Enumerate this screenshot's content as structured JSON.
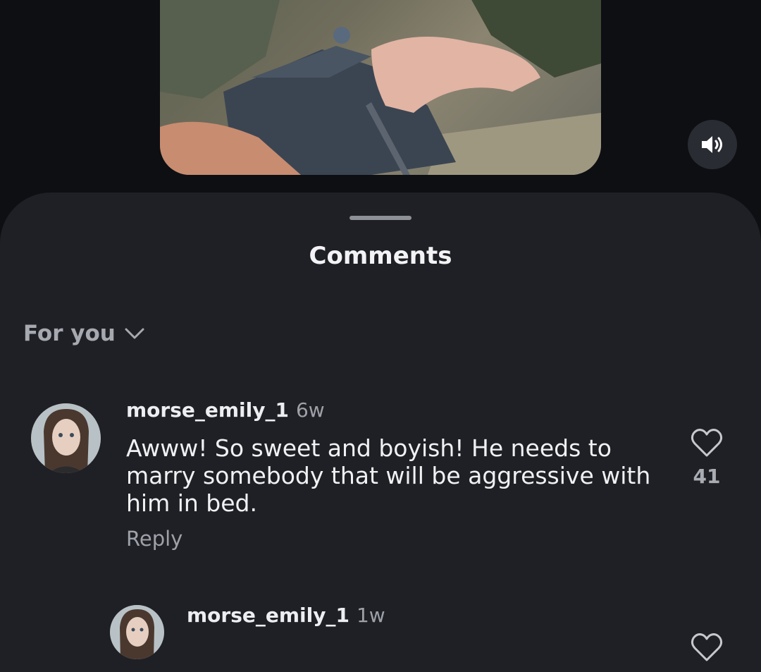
{
  "colors": {
    "background": "#0d0f13",
    "sheet": "#1f2025",
    "text_primary": "#f0f1f3",
    "text_secondary": "#9ea1a8"
  },
  "media": {
    "mute_icon": "speaker-sound-icon"
  },
  "sheet": {
    "title": "Comments",
    "filter_label": "For you",
    "filter_icon": "chevron-down-icon"
  },
  "comments": [
    {
      "username": "morse_emily_1",
      "time": "6w",
      "text": "Awww! So sweet and boyish! He needs to marry somebody that will be aggressive with him in bed.",
      "reply_label": "Reply",
      "likes": "41",
      "like_icon": "heart-outline-icon"
    },
    {
      "username": "morse_emily_1",
      "time": "1w",
      "like_icon": "heart-outline-icon"
    }
  ]
}
